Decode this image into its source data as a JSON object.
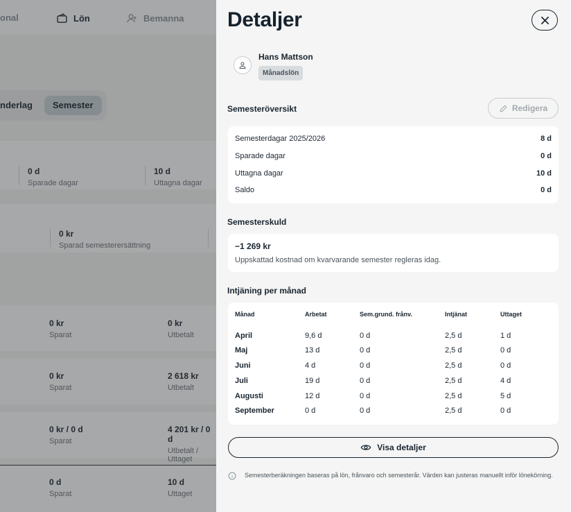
{
  "nav": {
    "items": [
      {
        "label": "onal"
      },
      {
        "label": "Lön"
      },
      {
        "label": "Bemanna"
      }
    ]
  },
  "tabs": {
    "items": [
      {
        "label": "nderlag"
      },
      {
        "label": "Semester"
      }
    ]
  },
  "background": {
    "summary": [
      {
        "value": "0 d",
        "label": "Sparade dagar"
      },
      {
        "value": "10 d",
        "label": "Uttagna dagar"
      }
    ],
    "compensation": {
      "value": "0 kr",
      "label": "Sparad semesterersättning"
    },
    "rows": [
      {
        "left_value": "0 kr",
        "left_label": "Sparat",
        "right_value": "0 kr",
        "right_label": "Utbetalt"
      },
      {
        "left_value": "0 kr",
        "left_label": "Sparat",
        "right_value": "2 618 kr",
        "right_label": "Utbetalt"
      },
      {
        "left_value": "0 kr / 0 d",
        "left_label": "Sparat",
        "right_value": "4 201 kr / 0 d",
        "right_label": "Utbetalt / Uttaget"
      },
      {
        "left_value": "0 d",
        "left_label": "Sparat",
        "right_value": "10 d",
        "right_label": "Uttaget"
      }
    ]
  },
  "drawer": {
    "title": "Detaljer",
    "person": {
      "name": "Hans Mattson",
      "badge": "Månadslön"
    },
    "overview": {
      "title": "Semesteröversikt",
      "edit_label": "Redigera",
      "rows": [
        {
          "label": "Semesterdagar 2025/2026",
          "value": "8 d"
        },
        {
          "label": "Sparade dagar",
          "value": "0 d"
        },
        {
          "label": "Uttagna dagar",
          "value": "10 d"
        },
        {
          "label": "Saldo",
          "value": "0 d"
        }
      ]
    },
    "debt": {
      "title": "Semesterskuld",
      "value": "−1 269 kr",
      "description": "Uppskattad kostnad om kvarvarande semester regleras idag."
    },
    "earnings": {
      "title": "Intjäning per månad",
      "columns": [
        "Månad",
        "Arbetat",
        "Sem.grund. frånv.",
        "Intjänat",
        "Uttaget"
      ],
      "rows": [
        [
          "April",
          "9,6 d",
          "0 d",
          "2,5 d",
          "1 d"
        ],
        [
          "Maj",
          "13 d",
          "0 d",
          "2,5 d",
          "0 d"
        ],
        [
          "Juni",
          "4 d",
          "0 d",
          "2,5 d",
          "0 d"
        ],
        [
          "Juli",
          "19 d",
          "0 d",
          "2,5 d",
          "4 d"
        ],
        [
          "Augusti",
          "12 d",
          "0 d",
          "2,5 d",
          "5 d"
        ],
        [
          "September",
          "0 d",
          "0 d",
          "2,5 d",
          "0 d"
        ]
      ]
    },
    "show_details_label": "Visa detaljer",
    "info_text": "Semesterberäkningen baseras på lön, frånvaro och semesterår. Värden kan justeras manuellt inför lönekörning."
  },
  "icons": {
    "nav_wallet": "wallet-icon",
    "nav_person": "person-add-icon",
    "close": "close-icon",
    "avatar": "user-icon",
    "edit": "pencil-icon",
    "eye": "eye-icon",
    "info": "info-icon"
  }
}
